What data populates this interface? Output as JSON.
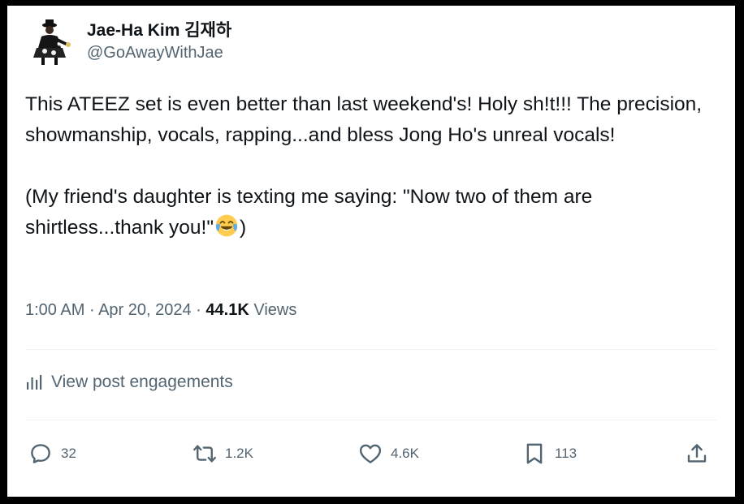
{
  "author": {
    "display_name": "Jae-Ha Kim 김재하",
    "handle": "@GoAwayWithJae",
    "avatar_icon": "avatar-photo"
  },
  "tweet": {
    "paragraph_1": "This ATEEZ set is even better than last weekend's! Holy sh!t!!! The precision, showmanship, vocals, rapping...and bless Jong Ho's unreal vocals!",
    "paragraph_2_start": "(My friend's daughter is texting me saying: \"Now two of them are shirtless...thank you!\"",
    "paragraph_2_end": ")",
    "emoji": "face-with-tears-of-joy"
  },
  "meta": {
    "time": "1:00 AM",
    "separator_1": "·",
    "date": "Apr 20, 2024",
    "separator_2": "·",
    "views_count": "44.1K",
    "views_label": "Views"
  },
  "engagements": {
    "label": "View post engagements",
    "icon": "analytics-icon"
  },
  "actions": {
    "replies": "32",
    "reposts": "1.2K",
    "likes": "4.6K",
    "bookmarks": "113"
  },
  "colors": {
    "text_primary": "#0f1419",
    "text_secondary": "#536471",
    "divider": "#eff3f4",
    "emoji_yellow": "#ffcc4d",
    "emoji_tears": "#5dadec"
  }
}
